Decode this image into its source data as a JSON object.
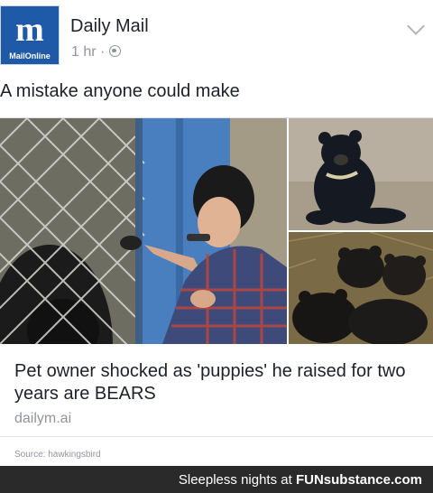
{
  "header": {
    "logo_text": "m",
    "logo_subtext": "MailOnline",
    "page_name": "Daily Mail",
    "time_ago": "1 hr",
    "separator": "·",
    "privacy_icon": "globe-icon",
    "options_icon": "chevron-down-icon"
  },
  "post": {
    "caption": "A mistake anyone could make"
  },
  "link_card": {
    "headline": "Pet owner shocked as 'puppies' he raised for two years are BEARS",
    "domain": "dailym.ai"
  },
  "source": "Source: hawkingsbird",
  "watermark": {
    "prefix": "Sleepless nights at",
    "brand": "FUNsubstance.com"
  },
  "colors": {
    "logo_bg": "#1f5aa8",
    "text": "#1d2129",
    "secondary_text": "#90949c",
    "watermark_bar": "#2a2a2a"
  }
}
